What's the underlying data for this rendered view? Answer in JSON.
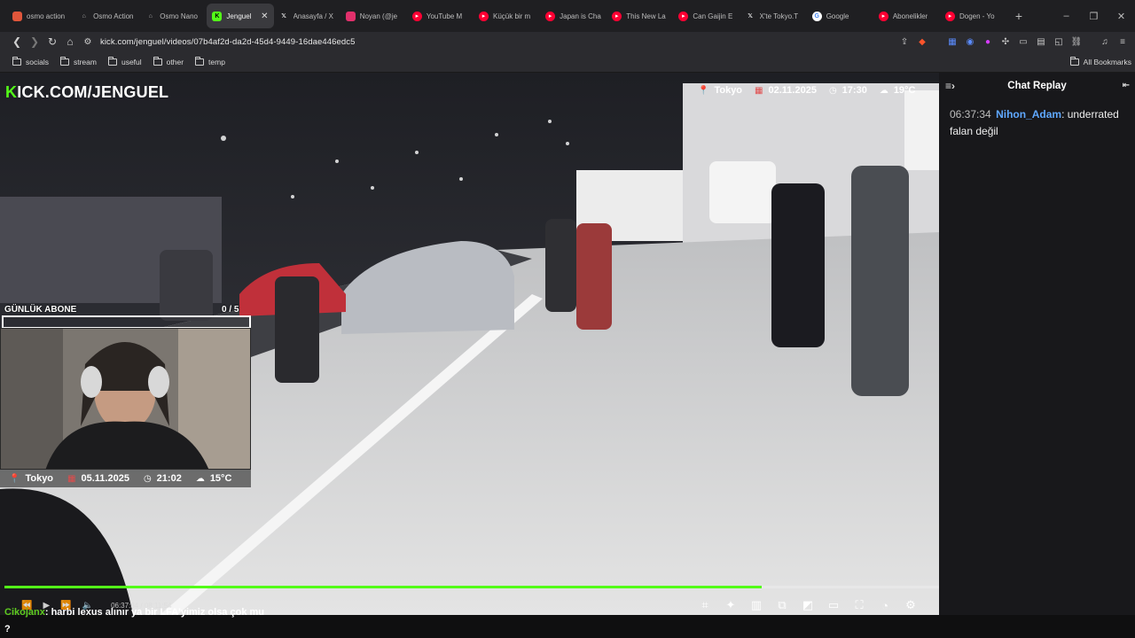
{
  "tabs": [
    {
      "label": "osmo action",
      "icon": "colorful-icon",
      "color": "#e0563b"
    },
    {
      "label": "Osmo Action",
      "icon": "tag-icon",
      "color": "#888888"
    },
    {
      "label": "Osmo Nano",
      "icon": "tag-icon",
      "color": "#888888"
    },
    {
      "label": "Jenguel",
      "icon": "kick-icon",
      "color": "#53fc18",
      "active": true
    },
    {
      "label": "Anasayfa / X",
      "icon": "x-icon",
      "color": "#ffffff"
    },
    {
      "label": "Noyan (@je",
      "icon": "instagram-icon",
      "color": "#e1306c"
    },
    {
      "label": "YouTube M",
      "icon": "youtube-music-icon",
      "color": "#ff0033"
    },
    {
      "label": "Küçük bir m",
      "icon": "youtube-icon",
      "color": "#ff0033"
    },
    {
      "label": "Japan is Cha",
      "icon": "youtube-icon",
      "color": "#ff0033"
    },
    {
      "label": "This New La",
      "icon": "youtube-icon",
      "color": "#ff0033"
    },
    {
      "label": "Can Gaijin E",
      "icon": "youtube-icon",
      "color": "#ff0033"
    },
    {
      "label": "X'te Tokyo.T",
      "icon": "x-icon",
      "color": "#ffffff"
    },
    {
      "label": "Google",
      "icon": "google-icon",
      "color": "#4285f4"
    },
    {
      "label": "Abonelikler",
      "icon": "youtube-icon",
      "color": "#ff0033"
    },
    {
      "label": "Dogen - Yo",
      "icon": "youtube-icon",
      "color": "#ff0033"
    }
  ],
  "address": {
    "url": "kick.com/jenguel/videos/07b4af2d-da2d-45d4-9449-16dae446edc5"
  },
  "bookmarks": [
    {
      "label": "socials"
    },
    {
      "label": "stream"
    },
    {
      "label": "useful"
    },
    {
      "label": "other"
    },
    {
      "label": "temp"
    }
  ],
  "all_bookmarks": "All Bookmarks",
  "overlay": {
    "logo_k": "K",
    "logo_rest": "ICK.COM/JENGUEL",
    "top_location": "Tokyo",
    "top_date": "02.11.2025",
    "top_time": "17:30",
    "top_temp": "19°C",
    "sub_label": "GÜNLÜK ABONE",
    "sub_count": "0 / 5",
    "bottom_location": "Tokyo",
    "bottom_date": "05.11.2025",
    "bottom_time": "21:02",
    "bottom_temp": "15°C"
  },
  "player": {
    "progress": 0.81,
    "timecode": "06:37:34 / 08:11:54"
  },
  "chat_overlay": {
    "user": "Cikojanx",
    "message": ": harbi lexus alınır ya bir LFA'yimiz olsa çok mu ?"
  },
  "chat": {
    "title": "Chat Replay",
    "messages": [
      {
        "time": "06:37:34",
        "user": "Nihon_Adam",
        "text": ": underrated falan değil"
      }
    ]
  },
  "colors": {
    "kick_green": "#53fc18",
    "chat_user": "#5fa8ff",
    "overlay_user": "#5ecb1f"
  }
}
